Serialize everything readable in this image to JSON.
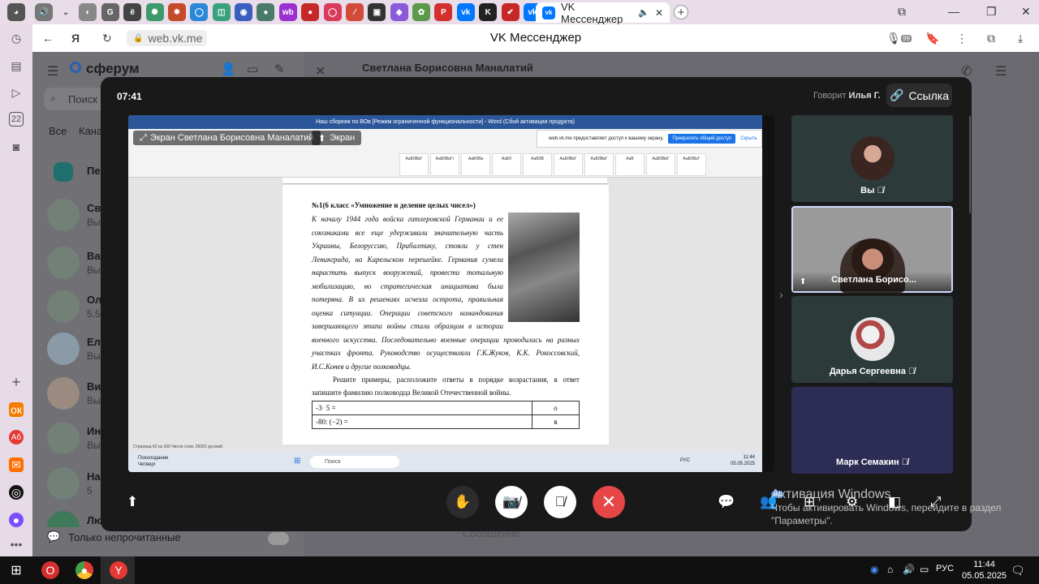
{
  "browser": {
    "active_tab_title": "VK Мессенджер",
    "url": "web.vk.me",
    "page_title": "VK Мессенджер",
    "badge_count": "99",
    "tab_favicons": [
      {
        "name": "tab-icon-1",
        "glyph": "◐",
        "color": "#888888"
      },
      {
        "name": "tab-icon-2",
        "glyph": "G",
        "color": "#666666"
      },
      {
        "name": "tab-icon-3",
        "glyph": "ё",
        "color": "#444444"
      },
      {
        "name": "tab-icon-4",
        "glyph": "✺",
        "color": "#3d9a6a"
      },
      {
        "name": "tab-icon-5",
        "glyph": "✸",
        "color": "#c44a2a"
      },
      {
        "name": "tab-icon-6",
        "glyph": "◯",
        "color": "#2b88d8"
      },
      {
        "name": "tab-icon-7",
        "glyph": "◫",
        "color": "#3aa17e"
      },
      {
        "name": "tab-icon-8",
        "glyph": "◉",
        "color": "#3a5fbf"
      },
      {
        "name": "tab-icon-9",
        "glyph": "●",
        "color": "#4a7a6a"
      },
      {
        "name": "tab-icon-10",
        "glyph": "wb",
        "color": "#9b2fd0"
      },
      {
        "name": "tab-icon-11",
        "glyph": "●",
        "color": "#c62828"
      },
      {
        "name": "tab-icon-12",
        "glyph": "◯",
        "color": "#d93a5a"
      },
      {
        "name": "tab-icon-13",
        "glyph": "⁄",
        "color": "#d24a3a"
      },
      {
        "name": "tab-icon-14",
        "glyph": "▣",
        "color": "#333333"
      },
      {
        "name": "tab-icon-15",
        "glyph": "◆",
        "color": "#8a5ad8"
      },
      {
        "name": "tab-icon-16",
        "glyph": "✿",
        "color": "#5a9a4a"
      },
      {
        "name": "tab-icon-17",
        "glyph": "P",
        "color": "#d32f2f"
      },
      {
        "name": "tab-icon-18",
        "glyph": "vk",
        "color": "#0077ff"
      },
      {
        "name": "tab-icon-19",
        "glyph": "K",
        "color": "#222222"
      },
      {
        "name": "tab-icon-20",
        "glyph": "✔",
        "color": "#c62828"
      },
      {
        "name": "tab-icon-21",
        "glyph": "vk",
        "color": "#0077ff"
      }
    ]
  },
  "messenger": {
    "brand": "сферум",
    "search_placeholder": "Поиск",
    "filters": [
      "Все",
      "Кана"
    ],
    "chat_title": "Светлана Борисовна Маналатий",
    "list": [
      {
        "name": "Пере",
        "sub": ""
      },
      {
        "name": "Све",
        "sub": "Вы"
      },
      {
        "name": "Вал",
        "sub": "Вы"
      },
      {
        "name": "Ол",
        "sub": "5.5"
      },
      {
        "name": "Еле",
        "sub": "Вы"
      },
      {
        "name": "Ви",
        "sub": "Вы"
      },
      {
        "name": "Ин",
        "sub": "Вы"
      },
      {
        "name": "На",
        "sub": "5"
      },
      {
        "name": "Лю",
        "sub": ""
      }
    ],
    "unread_only": "Только непрочитанные",
    "message_placeholder": "Сообщение"
  },
  "call": {
    "time": "07:41",
    "speaking_prefix": "Говорит",
    "speaking_name": "Илья Г.",
    "link_label": "Ссылка",
    "participants": [
      {
        "name": "Вы",
        "muted": true
      },
      {
        "name": "Светлана Борисо...",
        "muted": false
      },
      {
        "name": "Дарья Сергеевна",
        "muted": true
      },
      {
        "name": "Марк Семакин",
        "muted": true
      }
    ],
    "people_count": "84",
    "activation_line1": "Активация Windows",
    "activation_line2": "Чтобы активировать Windows, перейдите в раздел",
    "activation_line3": "\"Параметры\"."
  },
  "shared_screen": {
    "presenter_label": "Экран Светлана Борисовна Маналатий",
    "screen_chip": "Экран",
    "word_title": "Наш сборник по ВОв [Режим ограниченной функциональности] - Word (Сбой активации продукта)",
    "share_banner_text": "web.vk.me предоставляет доступ к вашему экрану.",
    "share_banner_stop": "Прекратить общий доступ",
    "share_banner_hide": "Скрыть",
    "ribbon_styles": [
      "АаБбВвГ",
      "АаБбВвГг",
      "АаБбВв",
      "АаБб",
      "АаБбВ",
      "АаБбВвГ",
      "АаБбВвГ",
      "АаВ",
      "АаБбВвГ",
      "АаБбВеГ"
    ],
    "doc_heading": "№1(6 класс «Умножение и деление целых чисел»)",
    "doc_body": "К началу 1944 года войска гитлеровской Германии и ее союзниками все еще удерживали значительную часть Украины, Белоруссию, Прибалтику, стояли у стен Ленинграда, на Карельском перешейке. Германия сумела нарастить выпуск вооружений, провести тотальную мобилизацию, но стратегическая инициатива была потеряна. В их решениях исчезла острота, правильная оценка ситуации. Операции советского командования завершающего этапа войны стали образцом в истории военного искусства. Последовательно военные операции проводились на разных участках фронта. Руководство осуществляли Г.К.Жуков, К.К. Рокоссовский, И.С.Конев и другие полководцы.",
    "doc_task": "Решите примеры, расположите ответы в порядке возрастания, в ответ запишите фамилию полководца Великой Отечественной войны.",
    "table_rows": [
      {
        "expr": "-3· 5 =",
        "letter": "о"
      },
      {
        "expr": "-80: (−2) =",
        "letter": "в"
      }
    ],
    "status_text": "Страница 62 из 160    Число слов: 25091    русский",
    "weather_line1": "Похолодание",
    "weather_line2": "Четверг",
    "search_label": "Поиск",
    "tray_lang": "РУС",
    "tray_time": "11:44",
    "tray_date": "05.05.2025"
  },
  "taskbar": {
    "lang": "РУС",
    "time": "11:44",
    "date": "05.05.2025"
  }
}
